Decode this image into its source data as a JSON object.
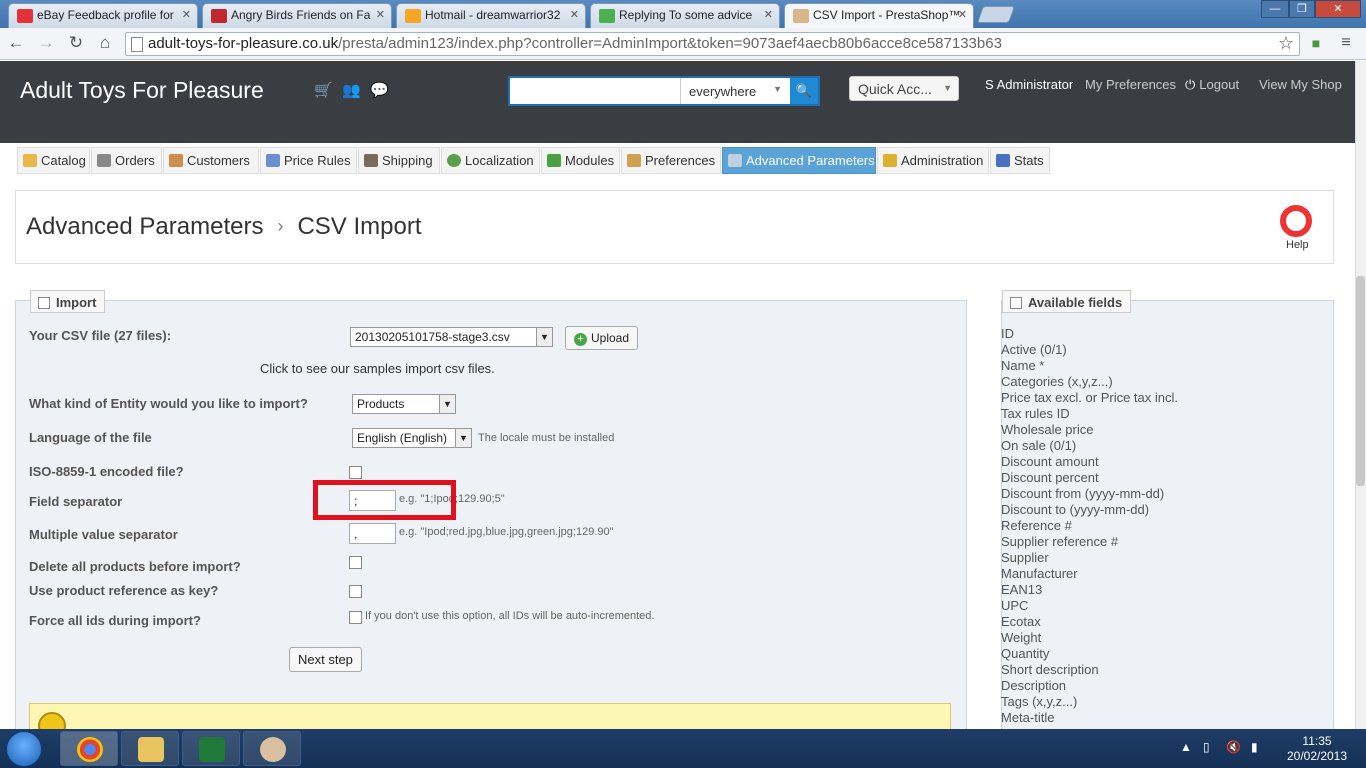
{
  "browser": {
    "tabs": [
      {
        "title": "eBay Feedback profile for",
        "favicon_color": "#e53238"
      },
      {
        "title": "Angry Birds Friends on Fa",
        "favicon_color": "#c0282d"
      },
      {
        "title": "Hotmail - dreamwarrior32",
        "favicon_color": "#f6a623"
      },
      {
        "title": "Replying To some advice",
        "favicon_color": "#4caf50"
      },
      {
        "title": "CSV Import - PrestaShop™",
        "favicon_color": "#d9b58a"
      }
    ],
    "url_host": "adult-toys-for-pleasure.co.uk",
    "url_path": "/presta/admin123/index.php?controller=AdminImport&token=9073aef4aecb80b6acce8ce587133b63",
    "window_controls": {
      "minimize": "—",
      "maximize": "❐",
      "close": "✕"
    }
  },
  "header": {
    "shop_name": "Adult Toys For Pleasure",
    "search_scope": "everywhere",
    "search_placeholder": "",
    "quick_access": "Quick Acc...",
    "employee": "S Administrator",
    "my_preferences": "My Preferences",
    "logout": "Logout",
    "view_shop": "View My Shop"
  },
  "menu": [
    {
      "label": "Catalog",
      "icon": "folder-icon",
      "color": "#e8b84a"
    },
    {
      "label": "Orders",
      "icon": "cart-icon",
      "color": "#888888"
    },
    {
      "label": "Customers",
      "icon": "user-icon",
      "color": "#d08a4a"
    },
    {
      "label": "Price Rules",
      "icon": "price-tag-icon",
      "color": "#6a8fd0"
    },
    {
      "label": "Shipping",
      "icon": "truck-icon",
      "color": "#7a6a5a"
    },
    {
      "label": "Localization",
      "icon": "globe-icon",
      "color": "#5aa04a"
    },
    {
      "label": "Modules",
      "icon": "puzzle-icon",
      "color": "#4aa040"
    },
    {
      "label": "Preferences",
      "icon": "preferences-icon",
      "color": "#d0a050"
    },
    {
      "label": "Advanced Parameters",
      "icon": "wrench-icon",
      "color": "#c0d0e0"
    },
    {
      "label": "Administration",
      "icon": "key-icon",
      "color": "#e0b030"
    },
    {
      "label": "Stats",
      "icon": "bar-chart-icon",
      "color": "#4a70c0"
    }
  ],
  "breadcrumb": {
    "parent": "Advanced Parameters",
    "current": "CSV Import",
    "separator": "›"
  },
  "help_label": "Help",
  "import": {
    "legend": "Import",
    "csv_file_label": "Your CSV file (27 files):",
    "csv_file_value": "20130205101758-stage3.csv",
    "upload_label": "Upload",
    "samples_link": "Click to see our samples import csv files.",
    "entity_label": "What kind of Entity would you like to import?",
    "entity_value": "Products",
    "language_label": "Language of the file",
    "language_value": "English (English)",
    "language_hint": "The locale must be installed",
    "iso_label": "ISO-8859-1 encoded file?",
    "field_sep_label": "Field separator",
    "field_sep_value": ";",
    "field_sep_hint": "e.g. \"1;Ipod;129.90;5\"",
    "multi_sep_label": "Multiple value separator",
    "multi_sep_value": ",",
    "multi_sep_hint": "e.g. \"Ipod;red.jpg,blue.jpg,green.jpg;129.90\"",
    "delete_label": "Delete all products before import?",
    "use_ref_label": "Use product reference as key?",
    "force_ids_label": "Force all ids during import?",
    "force_ids_hint": "If you don't use this option, all IDs will be auto-incremented.",
    "next_step": "Next step"
  },
  "available_fields": {
    "legend": "Available fields",
    "items": [
      "ID",
      "Active (0/1)",
      "Name *",
      "Categories (x,y,z...)",
      "Price tax excl. or Price tax incl.",
      "Tax rules ID",
      "Wholesale price",
      "On sale (0/1)",
      "Discount amount",
      "Discount percent",
      "Discount from (yyyy-mm-dd)",
      "Discount to (yyyy-mm-dd)",
      "Reference #",
      "Supplier reference #",
      "Supplier",
      "Manufacturer",
      "EAN13",
      "UPC",
      "Ecotax",
      "Weight",
      "Quantity",
      "Short description",
      "Description",
      "Tags (x,y,z...)",
      "Meta-title"
    ]
  },
  "taskbar": {
    "time": "11:35",
    "date": "20/02/2013"
  }
}
